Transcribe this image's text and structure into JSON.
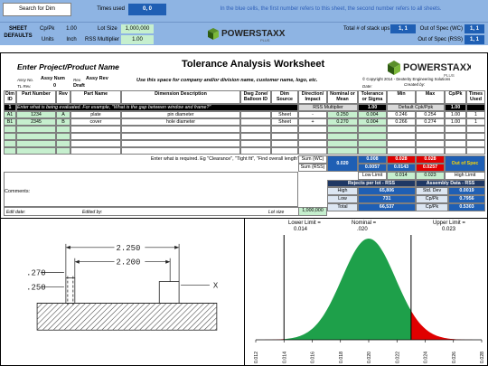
{
  "top": {
    "search_button": "Search for Dim",
    "times_used_label": "Times used",
    "times_used_value": "0, 0",
    "note": "In the blue cells, the first number refers to this sheet, the second number refers to all sheets."
  },
  "defaults": {
    "title": "SHEET DEFAULTS",
    "cp_pk_label": "Cp/Pk",
    "cp_pk_value": "1.00",
    "lot_size_label": "Lot Size",
    "lot_size_value": "1,000,000",
    "units_label": "Units",
    "units_value": "Inch",
    "rss_mult_label": "RSS Multiplier",
    "rss_mult_value": "1.00",
    "stackups_label": "Total # of stack ups",
    "stackups_value": "1, 1",
    "oos_wc_label": "Out of Spec (WC)",
    "oos_wc_value": "1, 1",
    "oos_rss_label": "Out of Spec (RSS)",
    "oos_rss_value": "1, 1"
  },
  "logo": {
    "brand": "POWERSTAXX",
    "suffix": "PLUS"
  },
  "header": {
    "project_title": "Enter Project/Product Name",
    "worksheet_title": "Tolerance Analysis Worksheet",
    "subtitle": "Use this space for company and/or division name, customer name, logo, etc.",
    "copyright": "© Copyright 2014 - Dexterity Engineering Solutions",
    "assy_no_label": "Assy No.",
    "assy_num": "Assy Num",
    "rev_label_small": "Rev.",
    "assy_rev": "Assy Rev",
    "tl_rev_label": "TL Rev.",
    "tl_rev": "0",
    "status": "Draft",
    "date_label": "Date:",
    "createdby_label": "Created by:"
  },
  "columns": {
    "dim_id": "Dim ID",
    "part_number": "Part Number",
    "rev": "Rev",
    "part_name": "Part Name",
    "dim_desc": "Dimension Description",
    "dwg_zone": "Dwg Zone/ Balloon ID",
    "dim_source": "Dim Source",
    "direction": "Direction/ Impact",
    "nominal": "Nominal or Mean",
    "tolerance": "Tolerance or Sigma",
    "min": "Min",
    "max": "Max",
    "cpk": "Cp/Pk",
    "times_used": "Times Used"
  },
  "summary_row": {
    "number": "1",
    "text": "Enter what is being evaluated. For example, \"What is the gap between window and frame?\"",
    "rss_multiplier_label": "RSS Multiplier",
    "rss_multiplier_value": "1.00",
    "default_cpk_label": "Default Cpk/Ppk",
    "default_cpk_value": "1.00"
  },
  "rows": [
    {
      "dim_id": "A1",
      "part_number": "1234",
      "rev": "A",
      "part_name": "plate",
      "dim_desc": "pin diameter",
      "dwg_zone": "",
      "dim_source": "Sheet",
      "direction": "-",
      "nominal": "0.250",
      "tolerance": "0.004",
      "min": "0.246",
      "max": "0.254",
      "cpk": "1.00",
      "times_used": "1"
    },
    {
      "dim_id": "B1",
      "part_number": "2345",
      "rev": "B",
      "part_name": "cover",
      "dim_desc": "hole diameter",
      "dwg_zone": "",
      "dim_source": "Sheet",
      "direction": "+",
      "nominal": "0.270",
      "tolerance": "0.004",
      "min": "0.266",
      "max": "0.274",
      "cpk": "1.00",
      "times_used": "1"
    }
  ],
  "results": {
    "require_text": "Enter what is required. Eg \"Clearance\", \"Tight fit\", \"Find overall length\"",
    "sum_wc_label": "Sum (WC)",
    "sum_rss_label": "Sum (RSS)",
    "nominal_sum": "0.020",
    "wc_min": "0.008",
    "wc_max": "0.028",
    "rss_min": "0.0057",
    "rss_max": "0.0143",
    "rss_extra": "0.0257",
    "oos_badge": "Out of Spec",
    "low_limit_label": "Low Limit",
    "low_limit_value": "0.014",
    "high_limit_value": "0.023",
    "high_limit_label": "High Limit",
    "rejects_header": "Rejects per lot - RSS",
    "assembly_header": "Assembly Data - RSS",
    "high_label": "High",
    "high_value": "65,806",
    "low_label": "Low",
    "low_value": "731",
    "total_label": "Total",
    "total_value": "66,537",
    "stddev_label": "Std. Dev",
    "stddev_value": "0.0019",
    "cpk_label": "Cp/Pk",
    "cpk_value": "0.7956",
    "cpk2_label": "Cp/Pk",
    "cpk2_value": "0.5303"
  },
  "footer": {
    "comments_label": "Comments:",
    "edit_date_label": "Edit date:",
    "edited_by_label": "Edited by:",
    "lot_size_label": "Lot size",
    "lot_size_value": "1,000,000"
  },
  "drawing": {
    "dim_outer": "2.250",
    "dim_inner": "2.200",
    "dim_left_top": ".270",
    "dim_left_bottom": ".250",
    "x_label": "X"
  },
  "chart_data": {
    "type": "area",
    "title": "",
    "lower_label": "Lower Limit =",
    "lower_value": "0.014",
    "nominal_label": "Nominal =",
    "nominal_value": ".020",
    "upper_label": "Upper Limit =",
    "upper_value": "0.023",
    "mean": 0.02,
    "sigma": 0.0019,
    "lower_limit": 0.014,
    "upper_limit": 0.023,
    "xlim": [
      0.012,
      0.028
    ],
    "x_ticks": [
      "0.012",
      "0.014",
      "0.016",
      "0.018",
      "0.020",
      "0.022",
      "0.024",
      "0.026",
      "0.028"
    ],
    "in_spec_color": "#1ea04a",
    "out_spec_color": "#e00000"
  }
}
